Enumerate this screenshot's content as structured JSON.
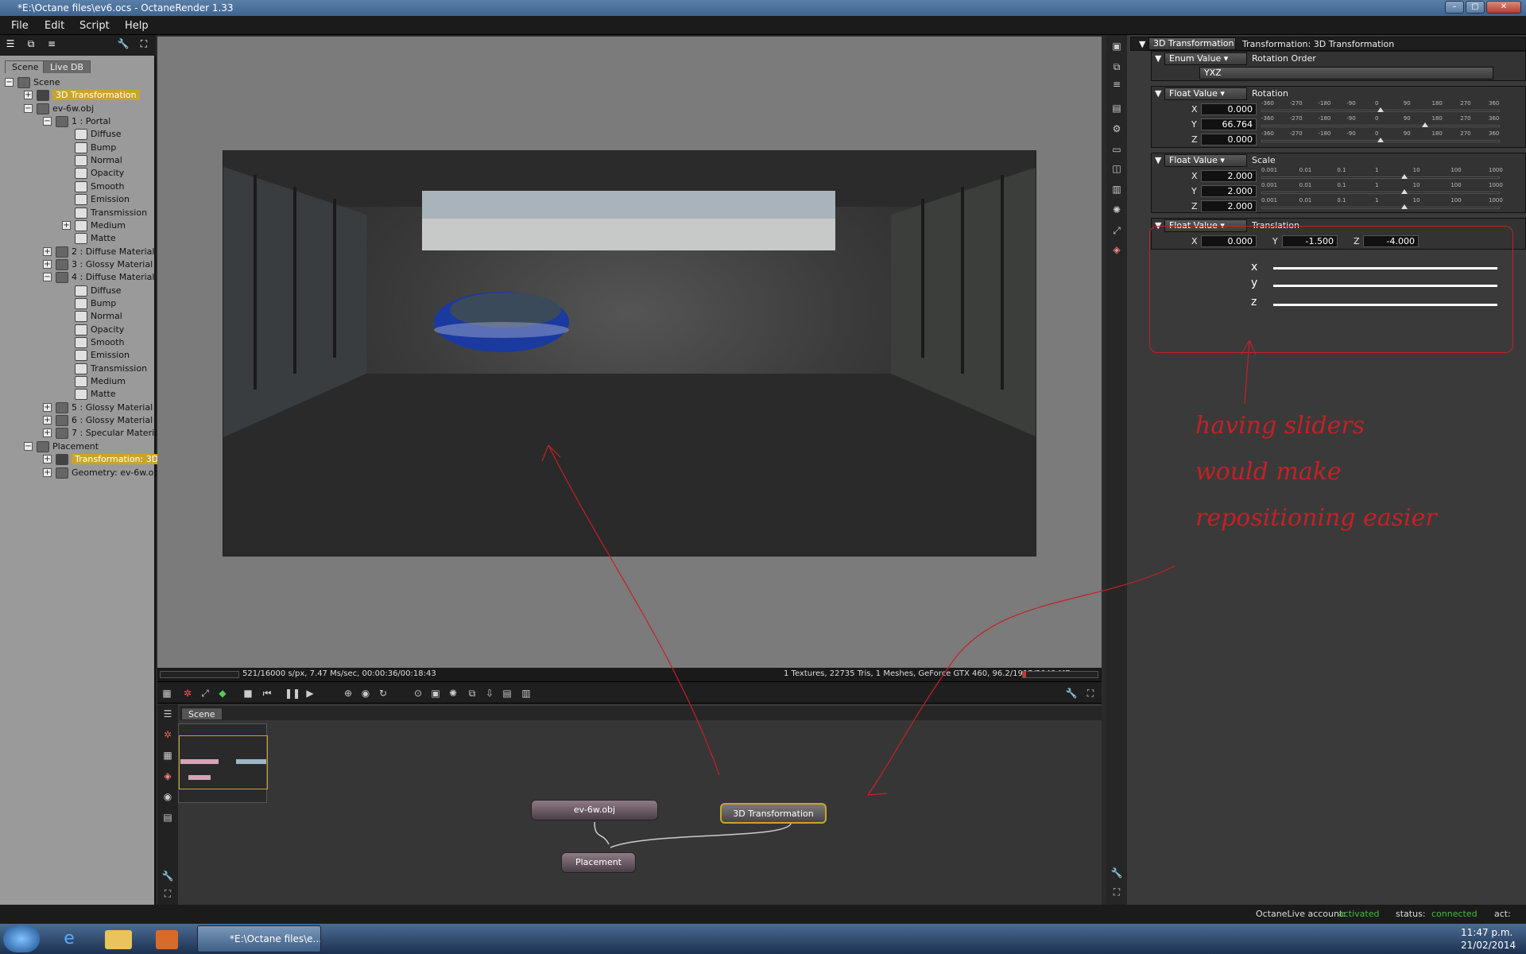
{
  "app": {
    "title": "*E:\\Octane files\\ev6.ocs - OctaneRender 1.33"
  },
  "menu": [
    "File",
    "Edit",
    "Script",
    "Help"
  ],
  "scene_tabs": [
    "Scene",
    "Live DB"
  ],
  "tree": [
    {
      "label": "Scene",
      "exp": "-"
    },
    {
      "label": "3D Transformation",
      "exp": "+",
      "selected": true
    },
    {
      "label": "ev-6w.obj",
      "exp": "-"
    },
    {
      "label": "1 : Portal",
      "exp": "-"
    },
    {
      "label": "Diffuse"
    },
    {
      "label": "Bump"
    },
    {
      "label": "Normal"
    },
    {
      "label": "Opacity"
    },
    {
      "label": "Smooth"
    },
    {
      "label": "Emission"
    },
    {
      "label": "Transmission"
    },
    {
      "label": "Medium",
      "exp": "+"
    },
    {
      "label": "Matte"
    },
    {
      "label": "2 : Diffuse Material",
      "exp": "+"
    },
    {
      "label": "3 : Glossy Material",
      "exp": "+"
    },
    {
      "label": "4 : Diffuse Material",
      "exp": "-"
    },
    {
      "label": "Diffuse"
    },
    {
      "label": "Bump"
    },
    {
      "label": "Normal"
    },
    {
      "label": "Opacity"
    },
    {
      "label": "Smooth"
    },
    {
      "label": "Emission"
    },
    {
      "label": "Transmission"
    },
    {
      "label": "Medium"
    },
    {
      "label": "Matte"
    },
    {
      "label": "5 : Glossy Material",
      "exp": "+"
    },
    {
      "label": "6 : Glossy Material",
      "exp": "+"
    },
    {
      "label": "7 : Specular Material",
      "exp": "+"
    },
    {
      "label": "Placement",
      "exp": "-"
    },
    {
      "label": "Transformation: 3D",
      "exp": "+",
      "selected": true
    },
    {
      "label": "Geometry: ev-6w.ob",
      "exp": "+"
    }
  ],
  "render_status": {
    "left": "521/16000 s/px, 7.47 Ms/sec, 00:00:36/00:18:43",
    "right": "1 Textures, 22735 Tris, 1 Meshes, GeForce GTX 460, 96.2/1915/2048 MB"
  },
  "nodegraph": {
    "tab": "Scene",
    "nodes": {
      "obj": "ev-6w.obj",
      "transform": "3D Transformation",
      "placement": "Placement"
    }
  },
  "inspector": {
    "header_type": "3D Transformation",
    "header_title": "Transformation: 3D Transformation",
    "rotation_order": {
      "type": "Enum Value",
      "label": "Rotation Order",
      "value": "YXZ"
    },
    "rotation": {
      "type": "Float Value",
      "label": "Rotation",
      "x": "0.000",
      "y": "66.764",
      "z": "0.000",
      "ticks": [
        "-360",
        "-270",
        "-180",
        "-90",
        "0",
        "90",
        "180",
        "270",
        "360"
      ],
      "levels": [
        0.5,
        0.685,
        0.5
      ]
    },
    "scale": {
      "type": "Float Value",
      "label": "Scale",
      "x": "2.000",
      "y": "2.000",
      "z": "2.000",
      "ticks": [
        "0.001",
        "0.01",
        "0.1",
        "1",
        "10",
        "100",
        "1000"
      ],
      "levels": [
        0.6,
        0.6,
        0.6
      ]
    },
    "translation": {
      "type": "Float Value",
      "label": "Translation",
      "x": "0.000",
      "y": "-1.500",
      "z": "-4.000",
      "ax": "X",
      "ay": "Y",
      "az": "Z"
    }
  },
  "annotation": {
    "line1": "having sliders",
    "line2": "would make",
    "line3": "repositioning easier",
    "x": "x",
    "y": "y",
    "z": "z"
  },
  "status": {
    "account_label": "OctaneLive account:",
    "account_value": "activated",
    "status_label": "status:",
    "status_value": "connected",
    "act": "act:"
  },
  "taskbar": {
    "item": "*E:\\Octane files\\e...",
    "time": "11:47 p.m.",
    "date": "21/02/2014"
  },
  "colors": {
    "selected": "#c8a52a",
    "accent_red": "#c62026",
    "green": "#3fbf3f"
  }
}
